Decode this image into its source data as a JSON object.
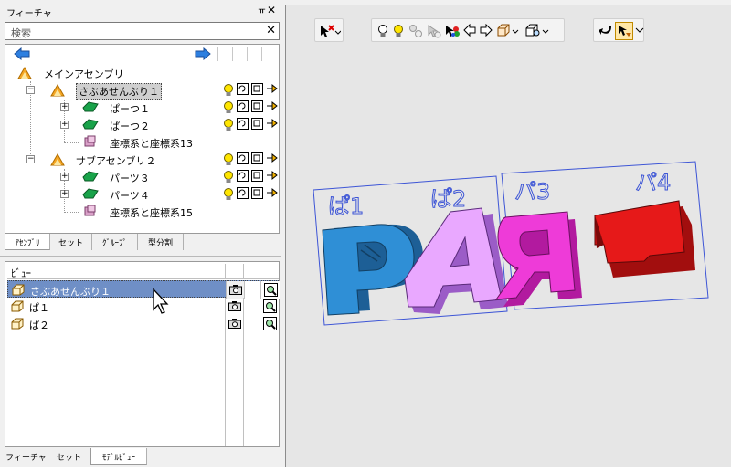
{
  "feature_panel": {
    "title": "フィーチャ",
    "search_placeholder": "検索"
  },
  "tree": {
    "root_label": "メインアセンブリ",
    "items": [
      {
        "label": "さぶあせんぶり１"
      },
      {
        "label": "ぱーつ１"
      },
      {
        "label": "ぱーつ２"
      },
      {
        "label": "座標系と座標系13"
      },
      {
        "label": "サブアセンブリ２"
      },
      {
        "label": "パーツ３"
      },
      {
        "label": "パーツ４"
      },
      {
        "label": "座標系と座標系15"
      }
    ]
  },
  "tabs_top": [
    "ｱｾﾝﾌﾞﾘ",
    "セット",
    "ｸﾞﾙｰﾌﾟ",
    "型分割"
  ],
  "view_panel": {
    "header": "ﾋﾞｭｰ",
    "rows": [
      "さぶあせんぶり１",
      "ぱ１",
      "ぱ２"
    ]
  },
  "tabs_bottom": [
    "フィーチャ",
    "セット",
    "ﾓﾃﾞﾙﾋﾞｭｰ"
  ],
  "canvas": {
    "view_labels": [
      "ぱ1",
      "ぱ2",
      "パ3",
      "パ4"
    ],
    "letters": [
      "P",
      "A",
      "R",
      "T"
    ],
    "colors": {
      "P": "#2f8fd6",
      "A": "#e9a8ff",
      "R": "#ee3bd8",
      "T": "#e61919",
      "frame": "#3d55d6",
      "selection": "#6f8fc6"
    }
  }
}
